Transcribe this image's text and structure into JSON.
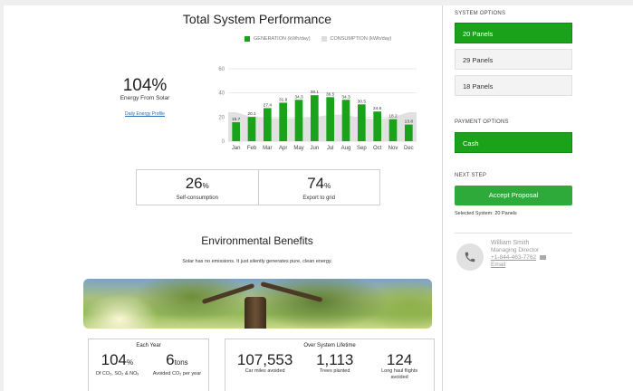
{
  "performance": {
    "title": "Total System Performance",
    "big_value": "104%",
    "big_label": "Energy From Solar",
    "daily_link": "Daily Energy Profile"
  },
  "chart_data": {
    "type": "bar",
    "categories": [
      "Jan",
      "Feb",
      "Mar",
      "Apr",
      "May",
      "Jun",
      "Jul",
      "Aug",
      "Sep",
      "Oct",
      "Nov",
      "Dec"
    ],
    "series": [
      {
        "name": "GENERATION (kWh/day)",
        "values": [
          15.7,
          20.1,
          27.4,
          31.9,
          34.3,
          38.1,
          36.5,
          34.3,
          30.5,
          24.6,
          18.2,
          13.8
        ],
        "color": "#1aa31a"
      },
      {
        "name": "CONSUMPTION (kWh/day)",
        "values": [
          24,
          20,
          19,
          19,
          19,
          20,
          22,
          22,
          19,
          18,
          20,
          24
        ],
        "color": "#dedede"
      }
    ],
    "yticks": [
      0,
      20,
      40,
      60
    ],
    "ylim": [
      0,
      60
    ],
    "data_labels": [
      "15.7",
      "20.1",
      "27.4",
      "31.9",
      "34.3",
      "38.1",
      "36.5",
      "34.3",
      "30.5",
      "24.6",
      "18.2",
      "13.8"
    ],
    "legend_position": "top"
  },
  "stats": {
    "self_consumption": {
      "value": "26",
      "unit": "%",
      "label": "Self-consumption"
    },
    "export": {
      "value": "74",
      "unit": "%",
      "label": "Export to grid"
    }
  },
  "environment": {
    "title": "Environmental Benefits",
    "subtitle": "Solar has no emissions. It just silently generates pure, clean energy.",
    "each_year": {
      "heading": "Each Year",
      "items": [
        {
          "value": "104",
          "unit": "%",
          "label": "Of CO₂, SO₂ & NOₓ"
        },
        {
          "value": "6",
          "unit": "tons",
          "label": "Avoided CO₂ per year"
        }
      ]
    },
    "lifetime": {
      "heading": "Over System Lifetime",
      "items": [
        {
          "value": "107,553",
          "label": "Car miles avoided"
        },
        {
          "value": "1,113",
          "label": "Trees planted"
        },
        {
          "value": "124",
          "label": "Long haul flights avoided"
        }
      ]
    }
  },
  "sidebar": {
    "system_options_label": "SYSTEM OPTIONS",
    "system_options": [
      {
        "label": "20 Panels",
        "selected": true
      },
      {
        "label": "29 Panels",
        "selected": false
      },
      {
        "label": "18 Panels",
        "selected": false
      }
    ],
    "payment_options_label": "PAYMENT OPTIONS",
    "payment": {
      "label": "Cash",
      "selected": true
    },
    "next_step_label": "NEXT STEP",
    "accept_label": "Accept Proposal",
    "selected_system": "Selected System: 20 Panels",
    "contact": {
      "name": "William Smith",
      "title": "Managing Director",
      "phone": "+1-844-463-7762",
      "email": "Email",
      "avatar_icon": "phone-icon"
    }
  },
  "colors": {
    "accent": "#1aa31a",
    "consumption": "#dedede"
  }
}
